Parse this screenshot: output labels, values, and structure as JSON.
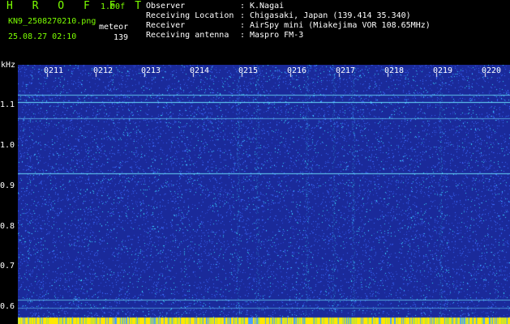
{
  "header": {
    "app_title": "H R O F F T",
    "version": "1.00f",
    "filename": "KN9_2508270210.png",
    "meteor_label": "meteor",
    "datetime": "25.08.27 02:10",
    "meteor_count": "139"
  },
  "metadata": [
    {
      "label": "Observer",
      "value": "K.Nagai"
    },
    {
      "label": "Receiving Location",
      "value": "Chigasaki, Japan (139.414 35.340)"
    },
    {
      "label": "Receiver",
      "value": "AirSpy mini (Miakejima VOR 108.65MHz)"
    },
    {
      "label": "Receiving antenna",
      "value": "Maspro FM-3"
    }
  ],
  "colon": ":",
  "y_axis": {
    "unit": "kHz",
    "ticks": [
      "1.1",
      "1.0",
      "0.9",
      "0.8",
      "0.7",
      "0.6"
    ]
  },
  "time_labels": [
    "0211",
    "0212",
    "0213",
    "0214",
    "0215",
    "0216",
    "0217",
    "0218",
    "0219",
    "0220"
  ],
  "colors": {
    "background": "#000000",
    "header_green": "#7cff00",
    "spectrogram_base": "#1a2a9a",
    "noise_light": "#3d6cff",
    "noise_cyan": "#38d8ff",
    "line_cyan": "#6fe8ff",
    "bottom_yellow": "#ffe800"
  }
}
